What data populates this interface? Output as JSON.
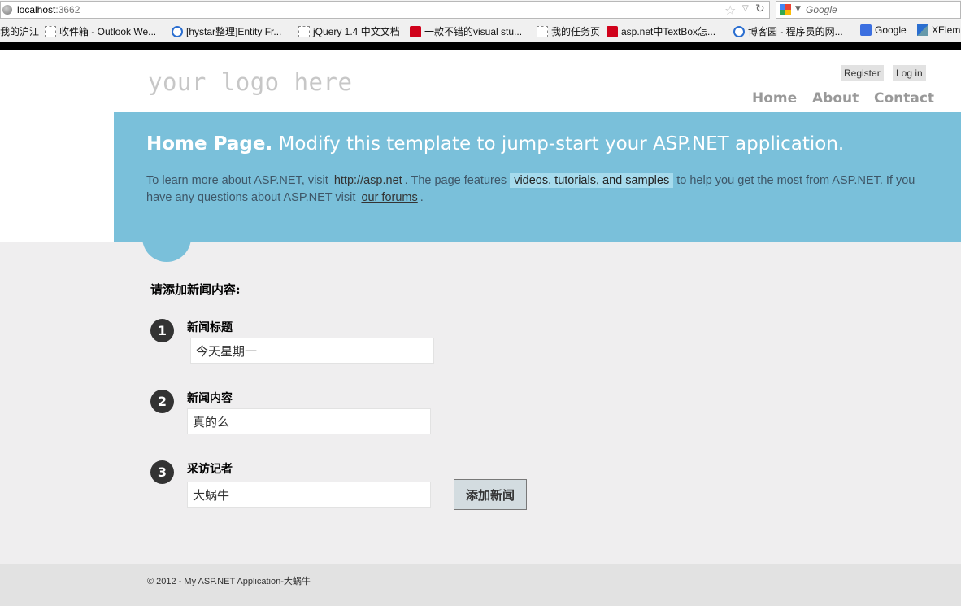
{
  "browser": {
    "url_host": "localhost",
    "url_port": ":3662",
    "search_placeholder": "Google",
    "bookmarks": [
      {
        "label": "我的沪江",
        "icon": "none"
      },
      {
        "label": "收件箱 - Outlook We...",
        "icon": "page"
      },
      {
        "label": "[hystar整理]Entity Fr...",
        "icon": "blue"
      },
      {
        "label": "jQuery 1.4 中文文档",
        "icon": "page"
      },
      {
        "label": "一款不错的visual stu...",
        "icon": "red"
      },
      {
        "label": "我的任务页",
        "icon": "page"
      },
      {
        "label": "asp.net中TextBox怎...",
        "icon": "red"
      },
      {
        "label": "博客园 - 程序员的网...",
        "icon": "blue"
      },
      {
        "label": "Google",
        "icon": "google"
      },
      {
        "label": "XElem",
        "icon": "x"
      }
    ]
  },
  "header": {
    "logo": "your logo here",
    "register_label": "Register",
    "login_label": "Log in",
    "nav": [
      "Home",
      "About",
      "Contact"
    ]
  },
  "featured": {
    "title_bold": "Home Page.",
    "title_rest": " Modify this template to jump-start your ASP.NET application.",
    "text_1": "To learn more about ASP.NET, visit ",
    "link_asp": "http://asp.net",
    "text_2": ". The page features ",
    "highlight": "videos, tutorials, and samples",
    "text_3": " to help you get the most from ASP.NET. If you have any questions about ASP.NET visit ",
    "link_forums": "our forums",
    "text_4": "."
  },
  "form": {
    "heading": "请添加新闻内容:",
    "steps": [
      {
        "num": "1",
        "label": "新闻标题",
        "value": "今天星期一"
      },
      {
        "num": "2",
        "label": "新闻内容",
        "value": "真的么"
      },
      {
        "num": "3",
        "label": "采访记者",
        "value": "大蜗牛"
      }
    ],
    "submit_label": "添加新闻"
  },
  "footer": {
    "text": "© 2012 - My ASP.NET Application-大蜗牛"
  },
  "colors": {
    "banner": "#7ac0da",
    "main_bg": "#efeeef",
    "footer_bg": "#e2e2e2"
  }
}
